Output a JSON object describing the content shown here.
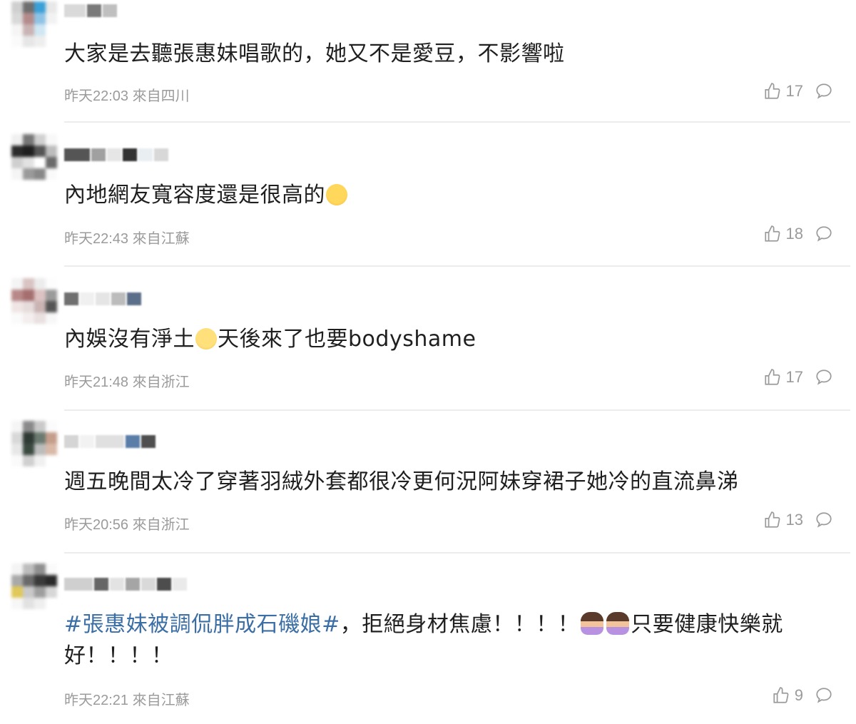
{
  "comments": [
    {
      "username": "小",
      "text": "大家是去聽張惠妹唱歌的，她又不是愛豆，不影響啦",
      "meta": "昨天22:03 來自四川",
      "likes": "17"
    },
    {
      "username": "",
      "text": "內地網友寬容度還是很高的",
      "meta": "昨天22:43 來自江蘇",
      "likes": "18"
    },
    {
      "username": "",
      "text_before": "內娛沒有淨土",
      "text_after": "天後來了也要bodyshame",
      "meta": "昨天21:48 來自浙江",
      "likes": "17"
    },
    {
      "username": "",
      "text": "週五晚間太冷了穿著羽絨外套都很冷更何況阿妹穿裙子她冷的直流鼻涕",
      "meta": "昨天20:56 來自浙江",
      "likes": "13"
    },
    {
      "username": "",
      "hashtag": "#張惠妹被調侃胖成石磯娘#",
      "text_mid": "，拒絕身材焦慮！！！！",
      "text_end": "只要健康快樂就好！！！！",
      "meta": "昨天22:21 來自江蘇",
      "likes": "9"
    }
  ],
  "icons": {
    "like": "thumbs-up-icon",
    "reply": "comment-bubble-icon"
  }
}
